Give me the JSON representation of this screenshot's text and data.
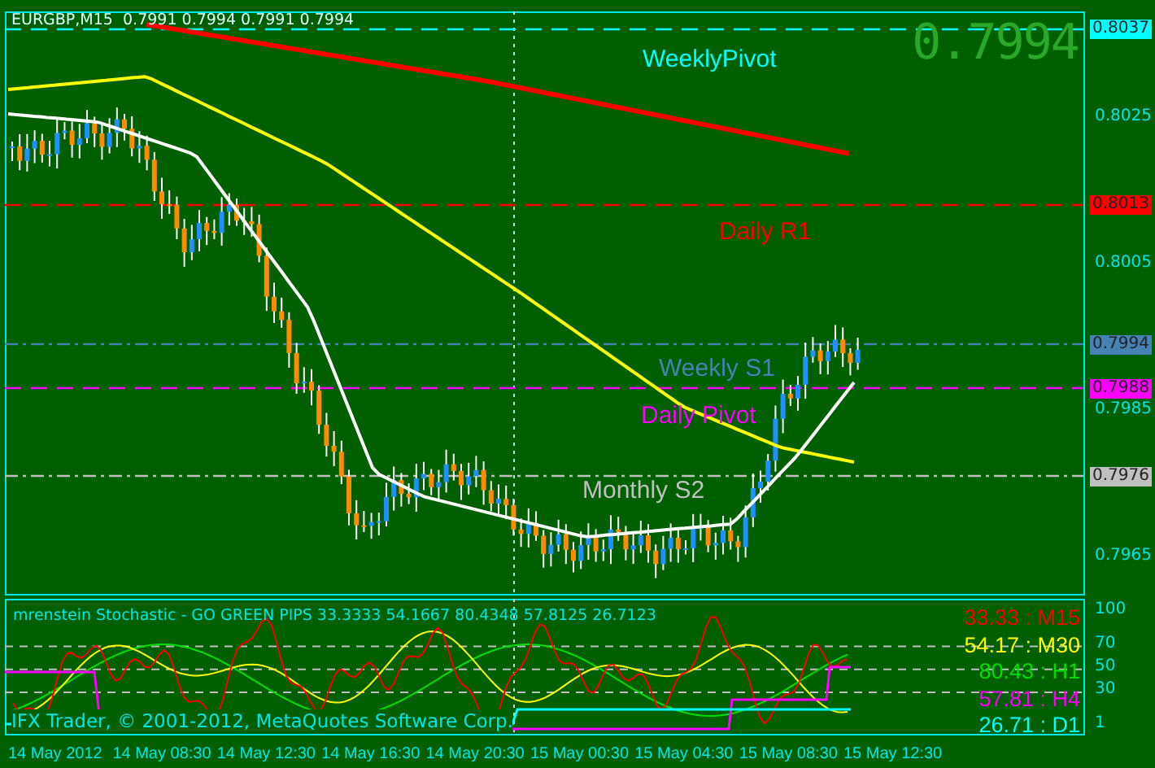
{
  "header": {
    "symbol": "EURGBP,M15",
    "ohlc": "0.7991 0.7994 0.7991 0.7994"
  },
  "big_price": "0.7994",
  "price_axis": {
    "ticks": [
      "0.8025",
      "0.8005",
      "0.7985",
      "0.7965"
    ]
  },
  "levels": [
    {
      "label": "WeeklyPivot",
      "price": "0.8037",
      "color": "#00ffff",
      "kind": "dashed"
    },
    {
      "label": "Daily R1",
      "price": "0.8013",
      "color": "#ff0000",
      "kind": "dashed"
    },
    {
      "label": "Weekly S1",
      "price": "0.7994",
      "color": "#4682b4",
      "kind": "dashdot"
    },
    {
      "label": "Daily Pivot",
      "price": "0.7988",
      "color": "#ff00ff",
      "kind": "dashed"
    },
    {
      "label": "Monthly S2",
      "price": "0.7976",
      "color": "#c0c0c0",
      "kind": "dashdot"
    }
  ],
  "indicator": {
    "title": "mrenstein Stochastic - GO GREEN PIPS 33.3333 54.1667 80.4348 57.8125 26.7123",
    "readouts": [
      {
        "text": "33.33 : M15",
        "color": "#ff0000"
      },
      {
        "text": "54.17 : M30",
        "color": "#ffff00"
      },
      {
        "text": "80.43 : H1",
        "color": "#00e000"
      },
      {
        "text": "57.81 : H4",
        "color": "#ff00ff"
      },
      {
        "text": "26.71 : D1",
        "color": "#00ffff"
      }
    ],
    "axis_ticks": [
      "100",
      "70",
      "50",
      "30",
      "1"
    ],
    "copyright": "IFX Trader, © 2001-2012, MetaQuotes Software Corp."
  },
  "time_axis": [
    "14 May 2012",
    "14 May 08:30",
    "14 May 12:30",
    "14 May 16:30",
    "14 May 20:30",
    "15 May 00:30",
    "15 May 04:30",
    "15 May 08:30",
    "15 May 12:30"
  ]
}
